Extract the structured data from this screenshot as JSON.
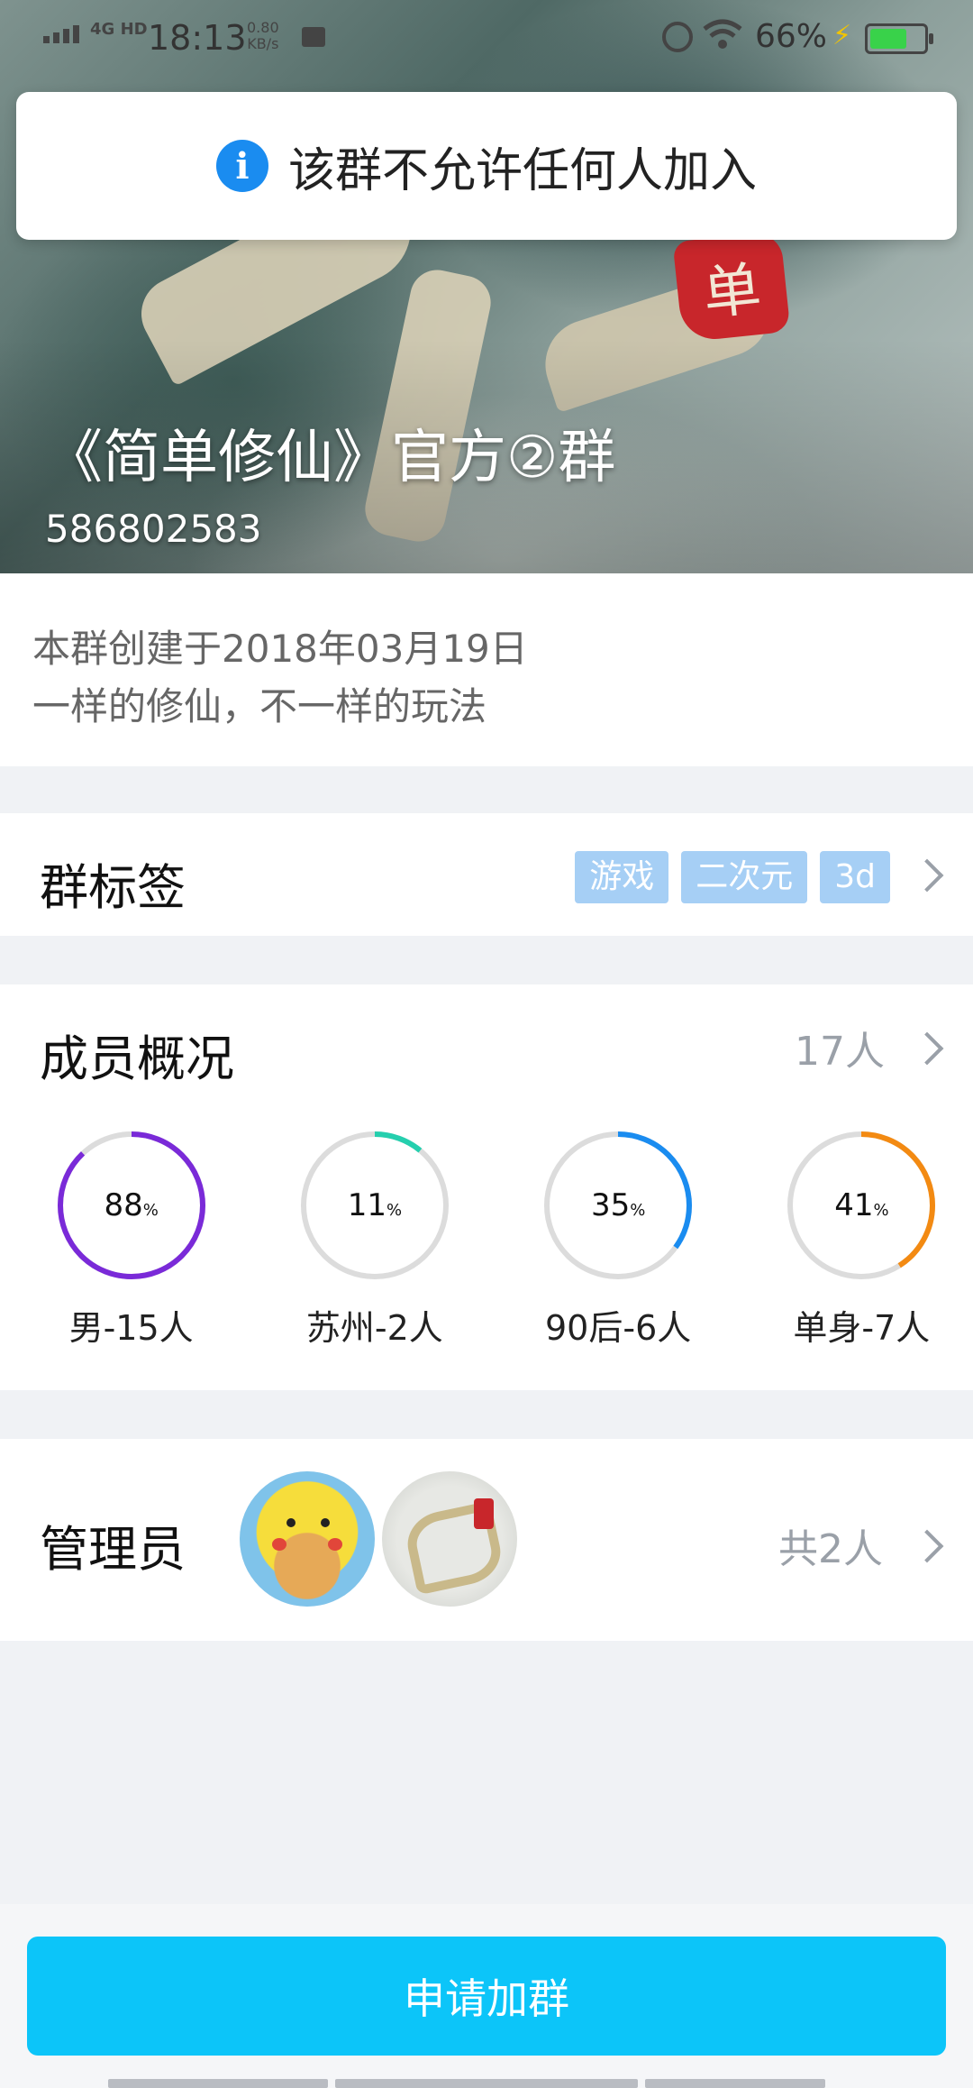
{
  "status_bar": {
    "network": "4G HD",
    "time": "18:13",
    "speed_value": "0.80",
    "speed_unit": "KB/s",
    "battery": "66%",
    "icons": [
      "signal-icon",
      "media-icon",
      "alarm-icon",
      "wifi-icon",
      "charging-icon",
      "battery-icon"
    ]
  },
  "toast": {
    "icon": "info-icon",
    "message": "该群不允许任何人加入"
  },
  "header": {
    "group_name": "《简单修仙》官方②群",
    "group_id": "586802583",
    "cover_seal_text": "单"
  },
  "description": {
    "created": "本群创建于2018年03月19日",
    "intro": "一样的修仙，不一样的玩法"
  },
  "tags_section": {
    "title": "群标签",
    "tags": [
      "游戏",
      "二次元",
      "3d"
    ]
  },
  "members_section": {
    "title": "成员概况",
    "count": "17人",
    "stats": [
      {
        "value": "88",
        "unit": "%",
        "label": "男-15人",
        "fraction": 0.88,
        "color": "#7a2ad8"
      },
      {
        "value": "11",
        "unit": "%",
        "label": "苏州-2人",
        "fraction": 0.11,
        "color": "#25cfae"
      },
      {
        "value": "35",
        "unit": "%",
        "label": "90后-6人",
        "fraction": 0.35,
        "color": "#1a8cf0"
      },
      {
        "value": "41",
        "unit": "%",
        "label": "单身-7人",
        "fraction": 0.41,
        "color": "#f38a12"
      }
    ]
  },
  "admins_section": {
    "title": "管理员",
    "count": "共2人",
    "avatars": [
      "pikachu-avatar",
      "jianshan-xiuxian-logo-avatar"
    ]
  },
  "actions": {
    "join_label": "申请加群"
  },
  "colors": {
    "accent": "#0cc5f9",
    "tag_bg": "#a6cff5",
    "info_blue": "#1a8cf0"
  }
}
